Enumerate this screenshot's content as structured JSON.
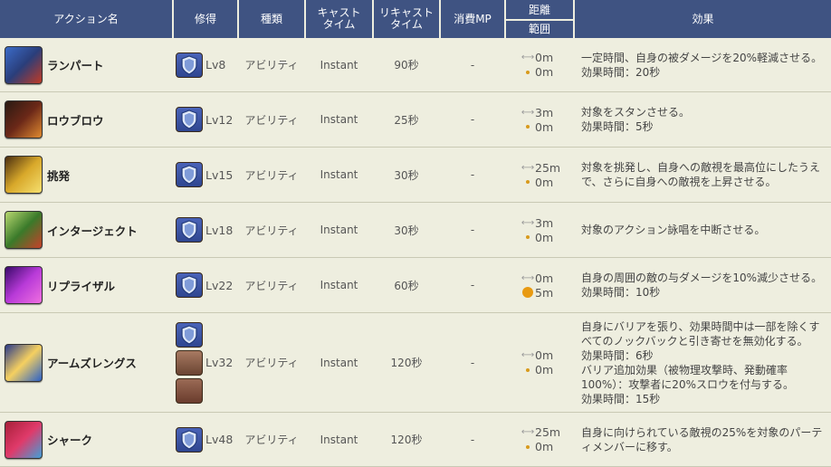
{
  "headers": {
    "name": "アクション名",
    "learn": "修得",
    "kind": "種類",
    "cast": "キャスト\nタイム",
    "recast": "リキャスト\nタイム",
    "mp": "消費MP",
    "distance": "距離",
    "range": "範囲",
    "effect": "効果"
  },
  "rows": [
    {
      "name": "ランパート",
      "icon": "rampart-icon",
      "lv": "Lv8",
      "kind": "アビリティ",
      "cast": "Instant",
      "recast": "90秒",
      "mp": "-",
      "distance": "0m",
      "range": "0m",
      "effect": [
        "一定時間、自身の被ダメージを20%軽減させる。",
        "効果時間：20秒"
      ]
    },
    {
      "name": "ロウブロウ",
      "icon": "low-blow-icon",
      "lv": "Lv12",
      "kind": "アビリティ",
      "cast": "Instant",
      "recast": "25秒",
      "mp": "-",
      "distance": "3m",
      "range": "0m",
      "effect": [
        "対象をスタンさせる。",
        "効果時間：5秒"
      ]
    },
    {
      "name": "挑発",
      "icon": "provoke-icon",
      "lv": "Lv15",
      "kind": "アビリティ",
      "cast": "Instant",
      "recast": "30秒",
      "mp": "-",
      "distance": "25m",
      "range": "0m",
      "effect": [
        "対象を挑発し、自身への敵視を最高位にしたうえ",
        "で、さらに自身への敵視を上昇させる。"
      ]
    },
    {
      "name": "インタージェクト",
      "icon": "interject-icon",
      "lv": "Lv18",
      "kind": "アビリティ",
      "cast": "Instant",
      "recast": "30秒",
      "mp": "-",
      "distance": "3m",
      "range": "0m",
      "effect": [
        "対象のアクション詠唱を中断させる。"
      ]
    },
    {
      "name": "リプライザル",
      "icon": "reprisal-icon",
      "lv": "Lv22",
      "kind": "アビリティ",
      "cast": "Instant",
      "recast": "60秒",
      "mp": "-",
      "distance": "0m",
      "range": "5m",
      "effect": [
        "自身の周囲の敵の与ダメージを10%減少させる。",
        "効果時間：10秒"
      ]
    },
    {
      "name": "アームズレングス",
      "icon": "arms-length-icon",
      "lv": "Lv32",
      "kind": "アビリティ",
      "cast": "Instant",
      "recast": "120秒",
      "mp": "-",
      "distance": "0m",
      "range": "0m",
      "effect": [
        "自身にバリアを張り、効果時間中は一部を除くす",
        "べてのノックバックと引き寄せを無効化する。",
        "効果時間：6秒",
        "バリア追加効果（被物理攻撃時、発動確率",
        "100%）：攻撃者に20%スロウを付与する。",
        "効果時間：15秒"
      ]
    },
    {
      "name": "シャーク",
      "icon": "shirk-icon",
      "lv": "Lv48",
      "kind": "アビリティ",
      "cast": "Instant",
      "recast": "120秒",
      "mp": "-",
      "distance": "25m",
      "range": "0m",
      "effect": [
        "自身に向けられている敵視の25%を対象のパーテ",
        "ィメンバーに移す。"
      ]
    }
  ],
  "colors": {
    "header_bg": "#3f5382",
    "page_bg": "#eeeedf",
    "range_dot": "#e89a12"
  }
}
